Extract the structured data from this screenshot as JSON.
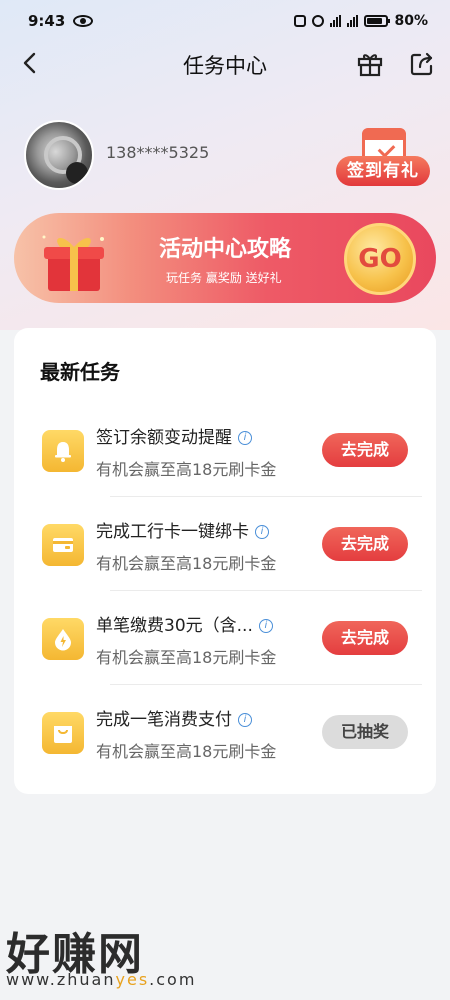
{
  "status_bar": {
    "time": "9:43",
    "battery": "80%"
  },
  "header": {
    "title": "任务中心"
  },
  "user": {
    "phone": "138****5325",
    "checkin_label": "签到有礼"
  },
  "banner": {
    "title": "活动中心攻略",
    "subtitle": "玩任务 赢奖励 送好礼",
    "go_label": "GO"
  },
  "tasks_section": {
    "title": "最新任务",
    "tasks": [
      {
        "name": "签订余额变动提醒",
        "desc": "有机会赢至高18元刷卡金",
        "button": "去完成",
        "icon": "bell-icon"
      },
      {
        "name": "完成工行卡一键绑卡",
        "desc": "有机会赢至高18元刷卡金",
        "button": "去完成",
        "icon": "card-icon"
      },
      {
        "name": "单笔缴费30元（含...",
        "desc": "有机会赢至高18元刷卡金",
        "button": "去完成",
        "icon": "drop-icon"
      },
      {
        "name": "完成一笔消费支付",
        "desc": "有机会赢至高18元刷卡金",
        "button": "已抽奖",
        "icon": "bag-icon"
      }
    ]
  },
  "watermark": {
    "brand": "好赚网",
    "url_pre": "www.zhuan",
    "url_hl": "yes",
    "url_post": ".com"
  },
  "colors": {
    "accent_red": "#e43d3f",
    "task_icon_yellow": "#f4b732",
    "done_gray": "#dcdcdc"
  }
}
